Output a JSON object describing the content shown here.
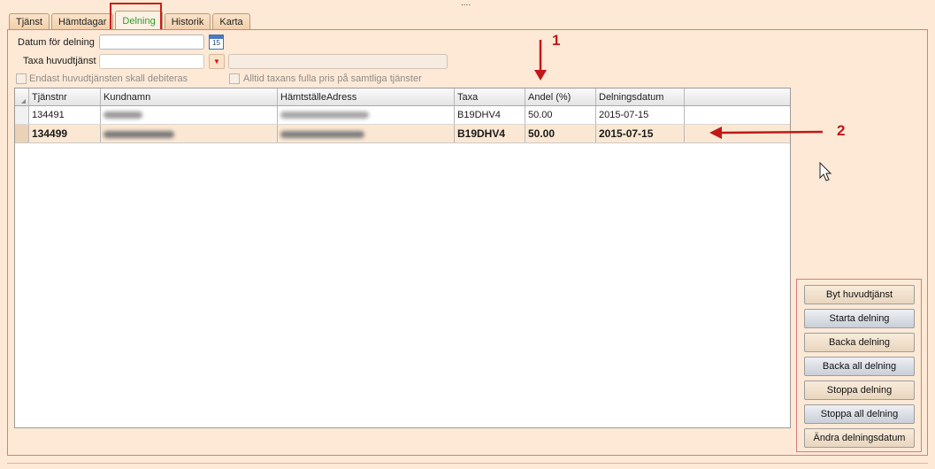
{
  "tabs": [
    "Tjänst",
    "Hämtdagar",
    "Delning",
    "Historik",
    "Karta"
  ],
  "active_tab": "Delning",
  "form": {
    "datum_label": "Datum för delning",
    "datum_value": "",
    "calendar_day": "15",
    "taxa_label": "Taxa huvudtjänst",
    "taxa_value": "",
    "cb1_label": "Endast huvudtjänsten skall debiteras",
    "cb2_label": "Alltid taxans fulla pris på samtliga tjänster"
  },
  "grid": {
    "headers": [
      "Tjänstnr",
      "Kundnamn",
      "HämtställeAdress",
      "Taxa",
      "Andel (%)",
      "Delningsdatum"
    ],
    "rows": [
      {
        "tjanstnr": "134491",
        "taxa": "B19DHV4",
        "andel": "50.00",
        "datum": "2015-07-15"
      },
      {
        "tjanstnr": "134499",
        "taxa": "B19DHV4",
        "andel": "50.00",
        "datum": "2015-07-15"
      }
    ]
  },
  "buttons": [
    "Byt huvudtjänst",
    "Starta delning",
    "Backa delning",
    "Backa all delning",
    "Stoppa delning",
    "Stoppa all delning",
    "Ändra delningsdatum"
  ],
  "annotations": {
    "one": "1",
    "two": "2"
  },
  "colors": {
    "annotation": "#c21818",
    "active_tab_text": "#2a9d2a",
    "panel_bg": "#fde9d6"
  }
}
